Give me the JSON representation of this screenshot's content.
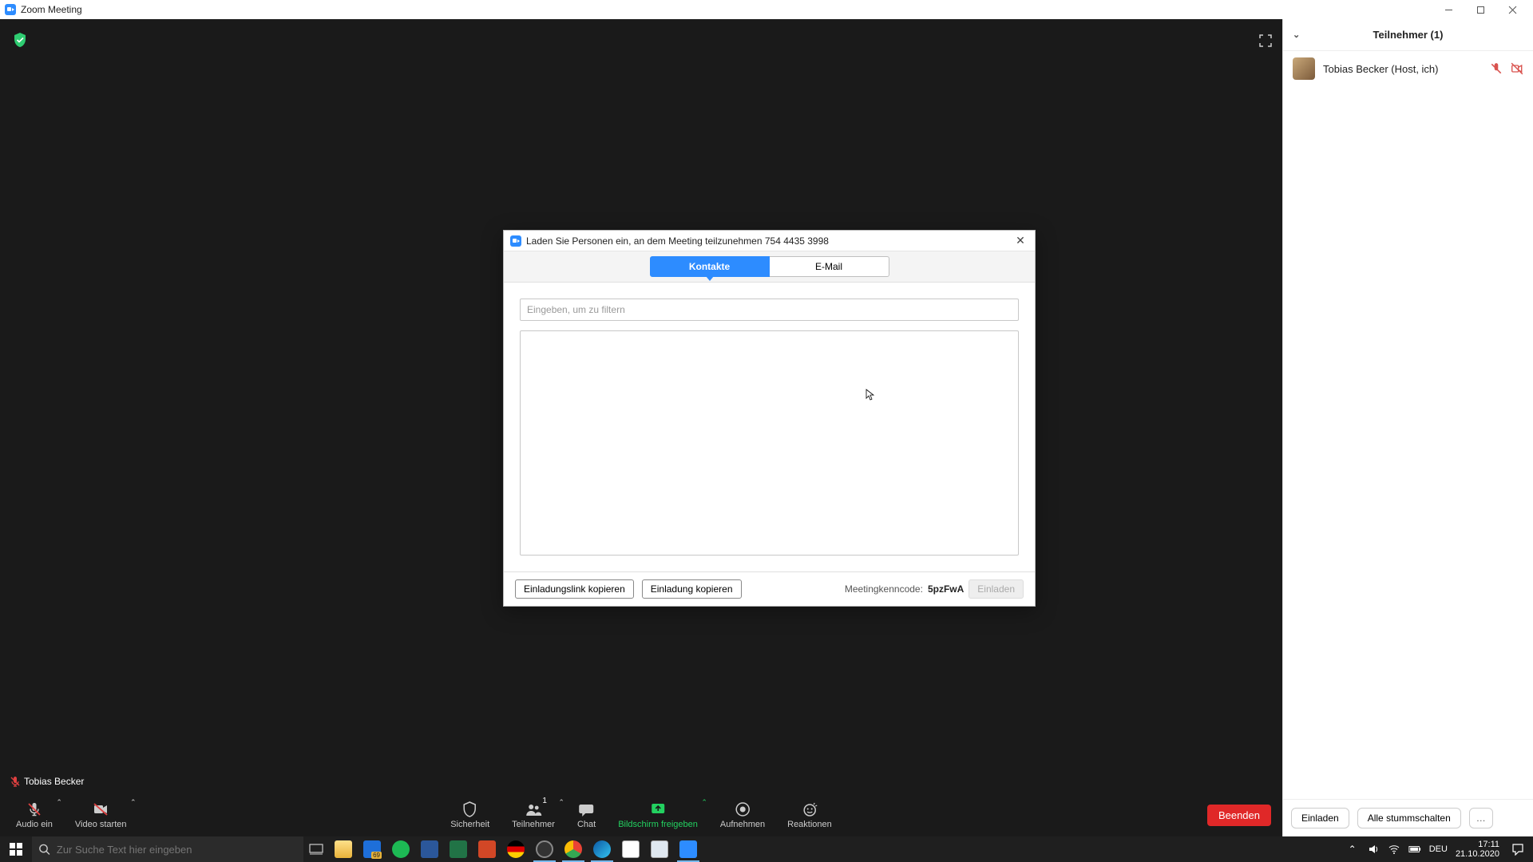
{
  "window": {
    "title": "Zoom Meeting"
  },
  "meeting_area": {
    "self_name": "Tobias Becker"
  },
  "controls": {
    "audio": "Audio ein",
    "video": "Video starten",
    "security": "Sicherheit",
    "participants": "Teilnehmer",
    "participants_count": "1",
    "chat": "Chat",
    "share": "Bildschirm freigeben",
    "record": "Aufnehmen",
    "reactions": "Reaktionen",
    "end": "Beenden"
  },
  "participants_panel": {
    "title": "Teilnehmer (1)",
    "items": [
      {
        "name": "Tobias Becker (Host, ich)"
      }
    ],
    "invite": "Einladen",
    "mute_all": "Alle stummschalten"
  },
  "invite_dialog": {
    "title": "Laden Sie Personen ein, an dem Meeting teilzunehmen 754 4435 3998",
    "tab_contacts": "Kontakte",
    "tab_email": "E-Mail",
    "filter_placeholder": "Eingeben, um zu filtern",
    "copy_link": "Einladungslink kopieren",
    "copy_invite": "Einladung kopieren",
    "code_label": "Meetingkenncode:",
    "code": "5pzFwA",
    "invite_btn": "Einladen"
  },
  "taskbar": {
    "search_placeholder": "Zur Suche Text hier eingeben",
    "lang": "DEU",
    "time": "17:11",
    "date": "21.10.2020",
    "mail_badge": "69"
  }
}
